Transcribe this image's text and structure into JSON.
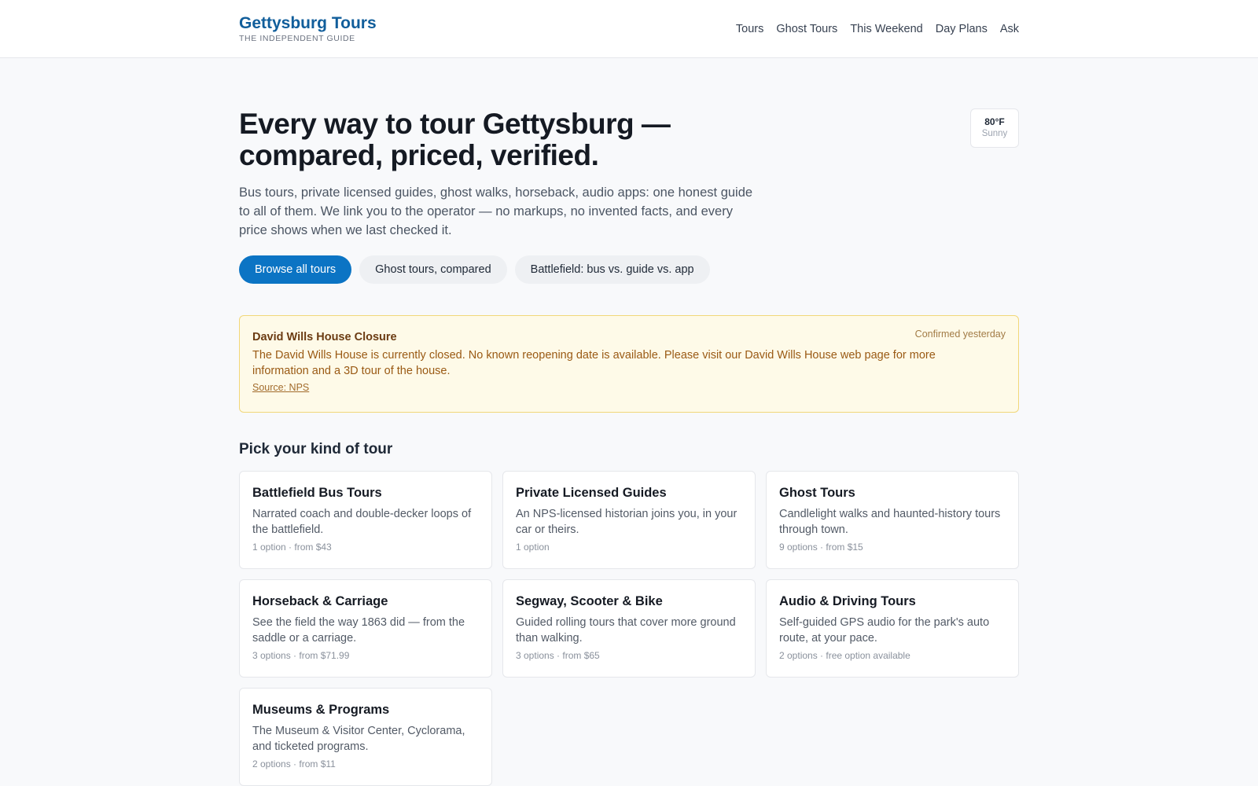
{
  "header": {
    "brand_title": "Gettysburg Tours",
    "brand_sub": "THE INDEPENDENT GUIDE",
    "nav": [
      "Tours",
      "Ghost Tours",
      "This Weekend",
      "Day Plans",
      "Ask"
    ]
  },
  "hero": {
    "title": "Every way to tour Gettysburg — compared, priced, verified.",
    "intro": "Bus tours, private licensed guides, ghost walks, horseback, audio apps: one honest guide to all of them. We link you to the operator — no markups, no invented facts, and every price shows when we last checked it.",
    "buttons": [
      "Browse all tours",
      "Ghost tours, compared",
      "Battlefield: bus vs. guide vs. app"
    ]
  },
  "weather": {
    "temp": "80°F",
    "condition": "Sunny"
  },
  "alert": {
    "title": "David Wills House Closure",
    "body": "The David Wills House is currently closed. No known reopening date is available. Please visit our David Wills House web page for more information and a 3D tour of the house.",
    "source": "Source: NPS",
    "confirmed": "Confirmed yesterday"
  },
  "section_title": "Pick your kind of tour",
  "categories": [
    {
      "title": "Battlefield Bus Tours",
      "desc": "Narrated coach and double-decker loops of the battlefield.",
      "meta": "1 option · from $43"
    },
    {
      "title": "Private Licensed Guides",
      "desc": "An NPS-licensed historian joins you, in your car or theirs.",
      "meta": "1 option"
    },
    {
      "title": "Ghost Tours",
      "desc": "Candlelight walks and haunted-history tours through town.",
      "meta": "9 options · from $15"
    },
    {
      "title": "Horseback & Carriage",
      "desc": "See the field the way 1863 did — from the saddle or a carriage.",
      "meta": "3 options · from $71.99"
    },
    {
      "title": "Segway, Scooter & Bike",
      "desc": "Guided rolling tours that cover more ground than walking.",
      "meta": "3 options · from $65"
    },
    {
      "title": "Audio & Driving Tours",
      "desc": "Self-guided GPS audio for the park's auto route, at your pace.",
      "meta": "2 options · free option available"
    },
    {
      "title": "Museums & Programs",
      "desc": "The Museum & Visitor Center, Cyclorama, and ticketed programs.",
      "meta": "2 options · from $11"
    }
  ]
}
